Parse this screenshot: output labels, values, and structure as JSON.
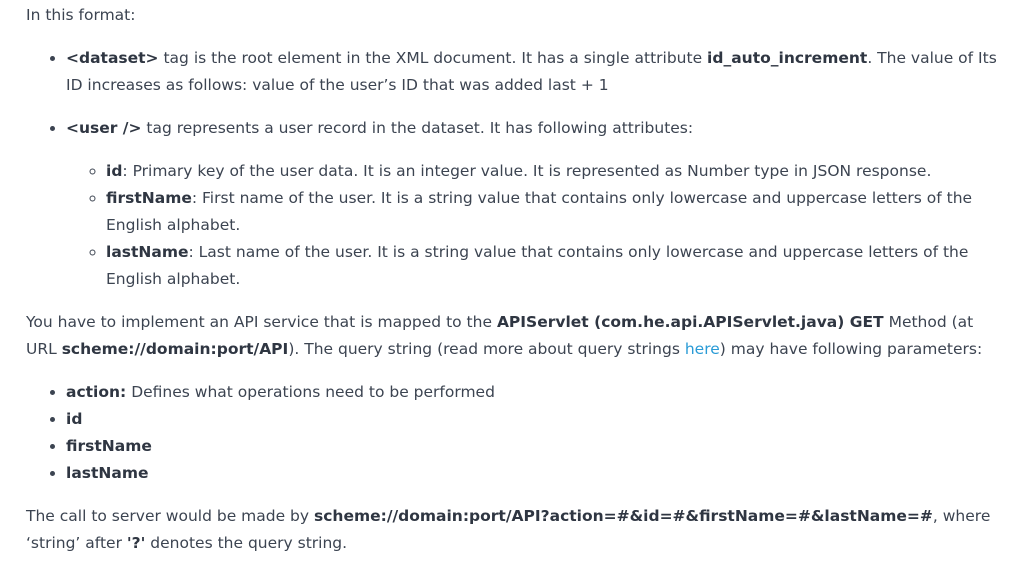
{
  "intro": "In this format:",
  "items": {
    "dataset": {
      "tag": "<dataset>",
      "t1": " tag is the root element in the XML document. It has a single attribute ",
      "attr": "id_auto_increment",
      "t2": ". The value of Its ID increases as follows: value of the user’s ID that was added last + 1"
    },
    "user": {
      "tag": "<user />",
      "t1": " tag represents a user record in the dataset. It has following attributes:",
      "attrs": [
        {
          "name": "id",
          "desc": ": Primary key of the user data. It is an integer value. It is represented as Number type in JSON response."
        },
        {
          "name": "firstName",
          "desc": ": First name of the user. It is a string value that contains only lowercase and uppercase letters of the English alphabet."
        },
        {
          "name": "lastName",
          "desc": ": Last name of the user. It is a string value that contains only lowercase and uppercase letters of the English alphabet."
        }
      ]
    }
  },
  "api": {
    "t1": "You have to implement an API service that is mapped to the ",
    "servlet": "APIServlet (com.he.api.APIServlet.java) GET",
    "t2": " Method (at URL ",
    "url": "scheme://domain:port/API",
    "t3": "). The query string (read more about query strings ",
    "link": "here",
    "t4": ") may have following parameters:"
  },
  "params": [
    {
      "name": "action:",
      "desc": " Defines what operations need to be performed"
    },
    {
      "name": "id",
      "desc": ""
    },
    {
      "name": "firstName",
      "desc": ""
    },
    {
      "name": "lastName",
      "desc": ""
    }
  ],
  "call": {
    "t1": "The call to server would be made by ",
    "url": "scheme://domain:port/API?action=#&id=#&firstName=#&lastName=#",
    "t2": ", where ‘string’ after ",
    "q": "'?'",
    "t3": " denotes the query string."
  }
}
